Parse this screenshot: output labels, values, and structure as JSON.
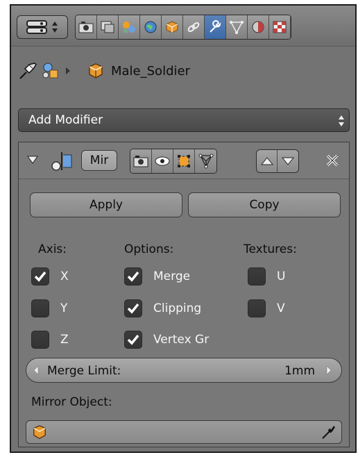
{
  "breadcrumb": {
    "object_name": "Male_Soldier"
  },
  "add_modifier": {
    "label": "Add Modifier"
  },
  "modifier": {
    "name": "Mir",
    "apply_label": "Apply",
    "copy_label": "Copy",
    "columns": {
      "axis": "Axis:",
      "options": "Options:",
      "textures": "Textures:"
    },
    "axis": [
      {
        "label": "X",
        "checked": true
      },
      {
        "label": "Y",
        "checked": false
      },
      {
        "label": "Z",
        "checked": false
      }
    ],
    "options": [
      {
        "label": "Merge",
        "checked": true
      },
      {
        "label": "Clipping",
        "checked": true
      },
      {
        "label": "Vertex Gr",
        "checked": true
      }
    ],
    "textures": [
      {
        "label": "U",
        "checked": false
      },
      {
        "label": "V",
        "checked": false
      }
    ],
    "merge_limit": {
      "label": "Merge Limit:",
      "value": "1mm"
    },
    "mirror_object": {
      "label": "Mirror Object:"
    }
  },
  "colors": {
    "panel": "#737373",
    "active_tab": "#4a76b0",
    "checkbox": "#363636",
    "check_mark": "#ffffff"
  },
  "icons": [
    "editor-type-icon",
    "render-icon",
    "render-layers-icon",
    "scene-icon",
    "world-icon",
    "object-icon",
    "constraints-icon",
    "modifier-wrench-icon",
    "data-mesh-icon",
    "material-icon",
    "texture-icon",
    "pin-icon",
    "scene-objects-icon",
    "cube-icon",
    "collapse-triangle-icon",
    "mirror-modifier-icon",
    "camera-icon",
    "eye-icon",
    "editmode-icon",
    "cage-icon",
    "move-up-icon",
    "move-down-icon",
    "close-icon",
    "eyedropper-icon"
  ]
}
